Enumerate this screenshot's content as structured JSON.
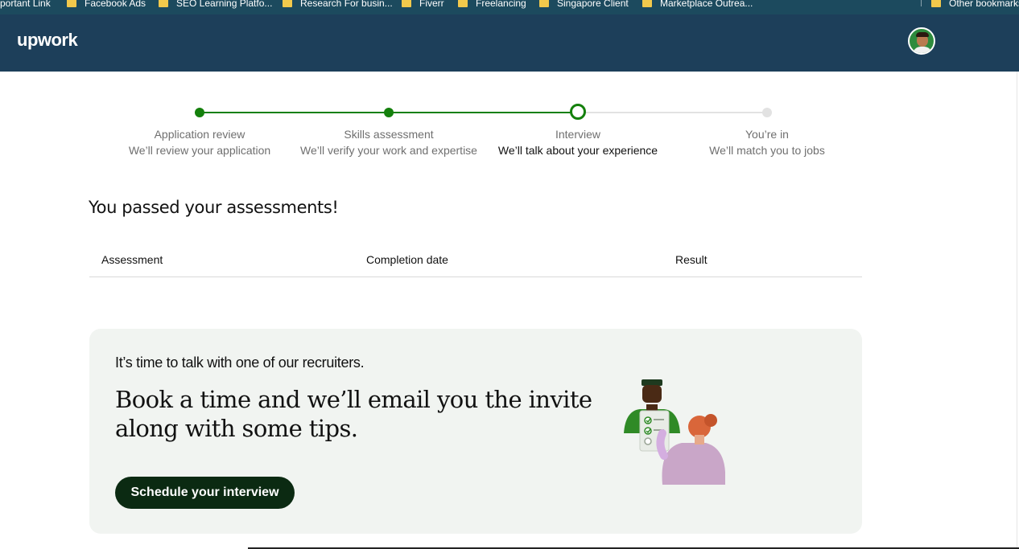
{
  "bookmarks": [
    {
      "label": "portant Link",
      "folder": false
    },
    {
      "label": "Facebook Ads",
      "folder": true
    },
    {
      "label": "SEO Learning Platfo...",
      "folder": true
    },
    {
      "label": "Research For busin...",
      "folder": true
    },
    {
      "label": "Fiverr",
      "folder": true
    },
    {
      "label": "Freelancing",
      "folder": true
    },
    {
      "label": "Singapore Client",
      "folder": true
    },
    {
      "label": "Marketplace Outrea...",
      "folder": true
    },
    {
      "label": "Other bookmarks",
      "folder": true
    }
  ],
  "header": {
    "logo": "upwork",
    "avatar_icon": "user-avatar-icon"
  },
  "stepper": {
    "steps": [
      {
        "title": "Application review",
        "subtitle": "We’ll review your application",
        "status": "done"
      },
      {
        "title": "Skills assessment",
        "subtitle": "We’ll verify your work and expertise",
        "status": "done"
      },
      {
        "title": "Interview",
        "subtitle": "We’ll talk about your experience",
        "status": "current"
      },
      {
        "title": "You’re in",
        "subtitle": "We’ll match you to jobs",
        "status": "todo"
      }
    ],
    "colors": {
      "done": "#14800c",
      "todo": "#e2e2e2"
    }
  },
  "assessments": {
    "title": "You passed your assessments!",
    "columns": [
      "Assessment",
      "Completion date",
      "Result"
    ]
  },
  "card": {
    "subtitle": "It’s time to talk with one of our recruiters.",
    "headline": "Book a time and we’ll email you the invite along with some tips.",
    "button": "Schedule your interview"
  }
}
